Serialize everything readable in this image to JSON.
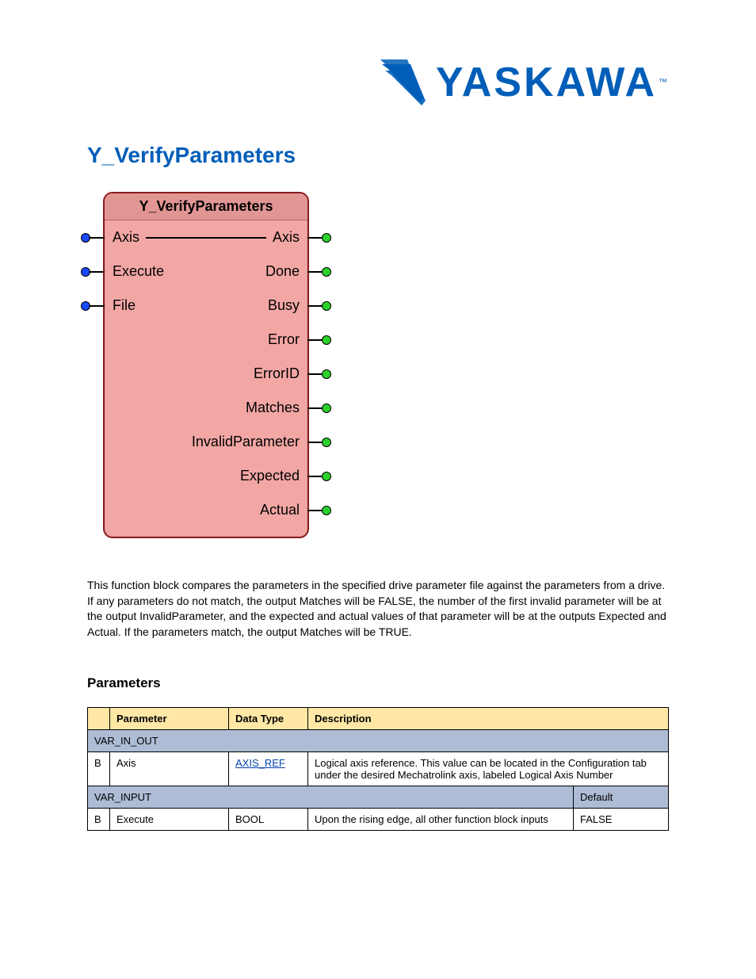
{
  "logo": {
    "text": "YASKAWA",
    "tm": "™"
  },
  "title": "Y_VerifyParameters",
  "fb": {
    "title": "Y_VerifyParameters",
    "inputs": [
      "Axis",
      "Execute",
      "File"
    ],
    "outputs": [
      "Axis",
      "Done",
      "Busy",
      "Error",
      "ErrorID",
      "Matches",
      "InvalidParameter",
      "Expected",
      "Actual"
    ]
  },
  "description": "This function block compares the parameters in the specified drive parameter file against the parameters from a drive. If any parameters do not match, the output Matches will be FALSE, the number of the first invalid parameter will be at the output InvalidParameter, and the expected and actual values of that parameter will be at the outputs Expected and Actual. If the parameters match, the output Matches will be TRUE.",
  "params_heading": "Parameters",
  "table": {
    "header": {
      "param": "Parameter",
      "type": "Data Type",
      "desc": "Description"
    },
    "var_in_out": "VAR_IN_OUT",
    "axis_row": {
      "b": "B",
      "param": "Axis",
      "type": "AXIS_REF",
      "desc": "Logical axis reference. This value can be located in the Configuration tab under the desired Mechatrolink axis, labeled Logical Axis Number"
    },
    "var_input": {
      "label": "VAR_INPUT",
      "def": "Default"
    },
    "execute_row": {
      "b": "B",
      "param": "Execute",
      "type": "BOOL",
      "desc": "Upon the rising edge, all other function block inputs",
      "def": "FALSE"
    }
  }
}
